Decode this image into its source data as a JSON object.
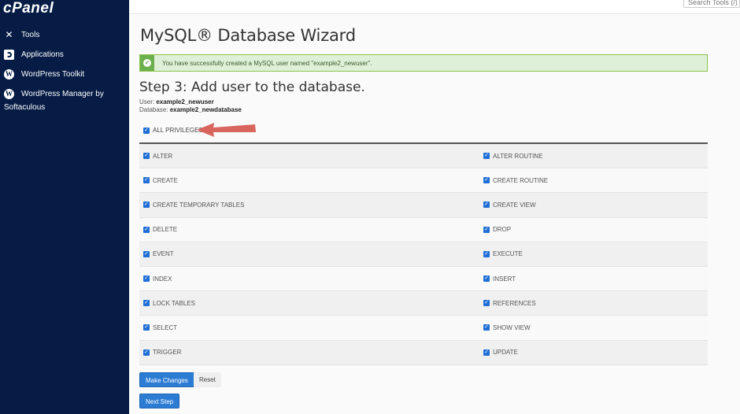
{
  "sidebar": {
    "logo": "cPanel",
    "items": [
      {
        "label": "Tools",
        "icon": "tools-icon"
      },
      {
        "label": "Applications",
        "icon": "applications-icon"
      },
      {
        "label": "WordPress Toolkit",
        "icon": "wordpress-icon"
      },
      {
        "label": "WordPress Manager by",
        "label2": "Softaculous",
        "icon": "wordpress-icon"
      }
    ]
  },
  "topbar": {
    "search_placeholder": "Search Tools (/)"
  },
  "page": {
    "title": "MySQL® Database Wizard",
    "alert": {
      "message": "You have successfully created a MySQL user named \"example2_newuser\".",
      "color": "#dff0d8"
    },
    "step_title": "Step 3: Add user to the database.",
    "user_label": "User:",
    "user_value": "example2_newuser",
    "database_label": "Database:",
    "database_value": "example2_newdatabase",
    "all_privileges": {
      "label": "ALL PRIVILEGES",
      "checked": true
    }
  },
  "privileges": [
    {
      "left": "ALTER",
      "right": "ALTER ROUTINE"
    },
    {
      "left": "CREATE",
      "right": "CREATE ROUTINE"
    },
    {
      "left": "CREATE TEMPORARY TABLES",
      "right": "CREATE VIEW"
    },
    {
      "left": "DELETE",
      "right": "DROP"
    },
    {
      "left": "EVENT",
      "right": "EXECUTE"
    },
    {
      "left": "INDEX",
      "right": "INSERT"
    },
    {
      "left": "LOCK TABLES",
      "right": "REFERENCES"
    },
    {
      "left": "SELECT",
      "right": "SHOW VIEW"
    },
    {
      "left": "TRIGGER",
      "right": "UPDATE"
    }
  ],
  "buttons": {
    "make_changes": "Make Changes",
    "reset": "Reset",
    "next_step": "Next Step"
  },
  "colors": {
    "sidebar": "#061c45",
    "primary": "#2c7cd4",
    "checkbox": "#1f6fd6",
    "annotation_arrow": "#d9665e"
  }
}
